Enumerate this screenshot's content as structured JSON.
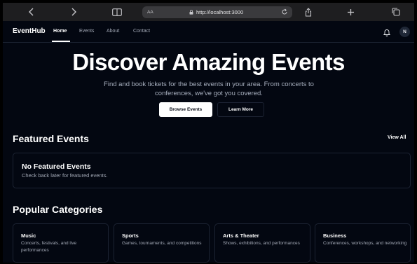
{
  "browser": {
    "address_prefix": "AA",
    "url": "http://localhost:3000"
  },
  "nav": {
    "brand": "EventHub",
    "links": [
      "Home",
      "Events",
      "About",
      "Contact"
    ],
    "avatar_initial": "N"
  },
  "hero": {
    "title": "Discover Amazing Events",
    "subtitle": "Find and book tickets for the best events in your area. From concerts to conferences, we've got you covered.",
    "primary_button": "Browse Events",
    "secondary_button": "Learn More"
  },
  "featured": {
    "title": "Featured Events",
    "view_all": "View All",
    "empty_title": "No Featured Events",
    "empty_subtitle": "Check back later for featured events."
  },
  "categories": {
    "title": "Popular Categories",
    "items": [
      {
        "name": "Music",
        "description": "Concerts, festivals, and live performances"
      },
      {
        "name": "Sports",
        "description": "Games, tournaments, and competitions"
      },
      {
        "name": "Arts & Theater",
        "description": "Shows, exhibitions, and performances"
      },
      {
        "name": "Business",
        "description": "Conferences, workshops, and networking"
      }
    ]
  },
  "colors": {
    "page_background": "#030711",
    "border": "#1c2333",
    "muted_text": "#a3a9b6",
    "primary_button_bg": "#ffffff"
  }
}
